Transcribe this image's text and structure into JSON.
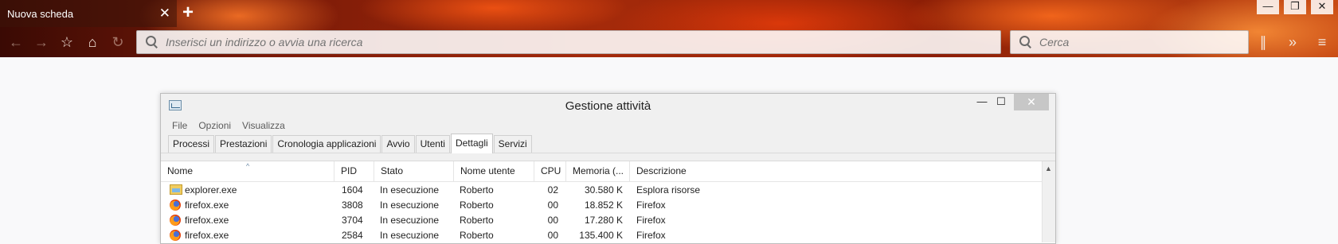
{
  "browser": {
    "tab_title": "Nuova scheda",
    "tab_close": "✕",
    "new_tab": "+",
    "url_placeholder": "Inserisci un indirizzo o avvia una ricerca",
    "search_placeholder": "Cerca",
    "window_controls": {
      "minimize": "—",
      "restore": "❐",
      "close": "✕"
    },
    "toolbar_icons": [
      "back-icon",
      "forward-icon",
      "bookmark-star-icon",
      "home-icon",
      "reload-icon",
      "library-icon",
      "overflow-icon",
      "menu-icon"
    ]
  },
  "task_manager": {
    "title": "Gestione attività",
    "controls": {
      "minimize": "—",
      "maximize": "☐",
      "close": "✕"
    },
    "menu": [
      "File",
      "Opzioni",
      "Visualizza"
    ],
    "tabs": [
      "Processi",
      "Prestazioni",
      "Cronologia applicazioni",
      "Avvio",
      "Utenti",
      "Dettagli",
      "Servizi"
    ],
    "active_tab": "Dettagli",
    "columns": {
      "name": "Nome",
      "pid": "PID",
      "status": "Stato",
      "user": "Nome utente",
      "cpu": "CPU",
      "memory": "Memoria (...",
      "description": "Descrizione"
    },
    "sort_indicator": "^",
    "rows": [
      {
        "icon": "explorer-icon",
        "name": "explorer.exe",
        "pid": "1604",
        "status": "In esecuzione",
        "user": "Roberto",
        "cpu": "02",
        "memory": "30.580 K",
        "description": "Esplora risorse"
      },
      {
        "icon": "firefox-icon",
        "name": "firefox.exe",
        "pid": "3808",
        "status": "In esecuzione",
        "user": "Roberto",
        "cpu": "00",
        "memory": "18.852 K",
        "description": "Firefox"
      },
      {
        "icon": "firefox-icon",
        "name": "firefox.exe",
        "pid": "3704",
        "status": "In esecuzione",
        "user": "Roberto",
        "cpu": "00",
        "memory": "17.280 K",
        "description": "Firefox"
      },
      {
        "icon": "firefox-icon",
        "name": "firefox.exe",
        "pid": "2584",
        "status": "In esecuzione",
        "user": "Roberto",
        "cpu": "00",
        "memory": "135.400 K",
        "description": "Firefox"
      }
    ]
  }
}
